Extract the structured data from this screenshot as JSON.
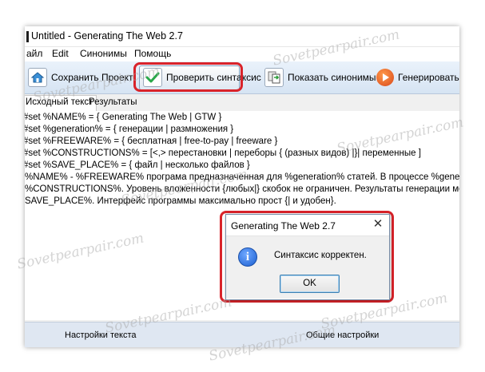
{
  "window": {
    "title": "Untitled - Generating The Web 2.7"
  },
  "menu": [
    {
      "label": "айл"
    },
    {
      "label": "Edit"
    },
    {
      "label": "Синонимы"
    },
    {
      "label": "Помощь"
    }
  ],
  "toolbar": {
    "save_project": "Сохранить Проект",
    "check_syntax": "Проверить синтаксис",
    "show_synonyms": "Показать синонимы",
    "generate": "Генерировать!"
  },
  "tabs": {
    "source": "Исходный текст",
    "results": "Результаты"
  },
  "editor": {
    "lines": [
      "#set %NAME% = { Generating The Web | GTW }",
      "#set %generation% = { генерации | размножения }",
      "#set %FREEWARE% = { бесплатная | free-to-pay | freeware }",
      "#set %CONSTRUCTIONS% = [<,> перестановки | переборы { (разных видов) |}| переменные ]",
      "#set %SAVE_PLACE% = { файл | несколько  файлов }",
      "%NAME% - %FREEWARE% програма предназначенная для %generation% статей. В процессе %generation",
      "%CONSTRUCTIONS%. Уровень вложенности {любых|} скобок не ограничен. Результаты генерации можн",
      "SAVE_PLACE%. Интерфейс программы максимально прост {| и удобен}."
    ]
  },
  "bottom": {
    "text_settings": "Настройки текста",
    "general_settings": "Общие настройки"
  },
  "dialog": {
    "title": "Generating The Web 2.7",
    "message": "Синтаксис корректен.",
    "ok": "OK",
    "close_glyph": "✕",
    "info_glyph": "i"
  },
  "watermark": "Sovetpearpair.com"
}
